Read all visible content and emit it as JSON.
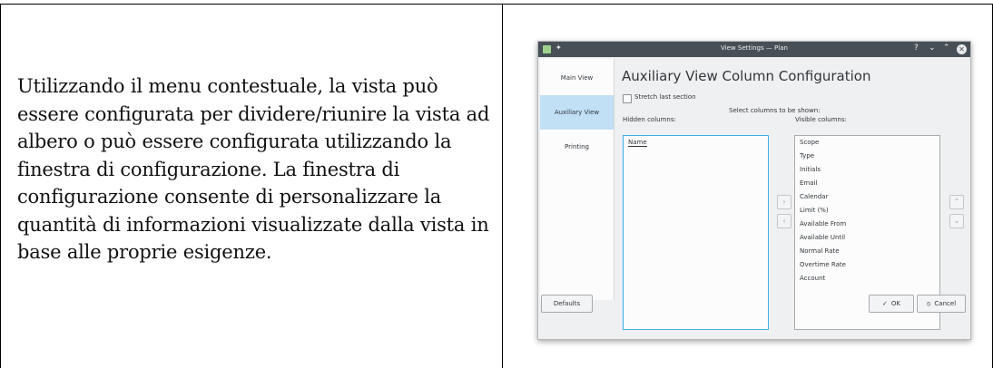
{
  "paragraph": "Utilizzando il menu contestuale, la vista può essere configurata per dividere/riunire la vista ad albero o può essere configurata utilizzando la finestra di configurazione. La finestra di configurazione consente di personalizzare la quantità di informazioni visualizzate dalla vista in base alle proprie esigenze.",
  "dialog": {
    "title": "View Settings — Plan",
    "titlebar_icons": {
      "app": "app-icon",
      "pin": "pin-icon",
      "help": "?",
      "minimize": "⌄",
      "maximize": "⌃",
      "close": "✕"
    },
    "sidebar": [
      {
        "label": "Main View",
        "selected": false
      },
      {
        "label": "Auxiliary View",
        "selected": true
      },
      {
        "label": "Printing",
        "selected": false
      }
    ],
    "heading": "Auxiliary View Column Configuration",
    "stretch_label": "Stretch last section",
    "stretch_checked": false,
    "select_label": "Select columns to be shown:",
    "hidden_label": "Hidden columns:",
    "visible_label": "Visible columns:",
    "hidden_columns": [
      "Name"
    ],
    "visible_columns": [
      "Scope",
      "Type",
      "Initials",
      "Email",
      "Calendar",
      "Limit (%)",
      "Available From",
      "Available Until",
      "Normal Rate",
      "Overtime Rate",
      "Account"
    ],
    "arrows": {
      "right": "›",
      "left": "‹",
      "up": "⌃",
      "down": "⌄"
    },
    "buttons": {
      "defaults": "Defaults",
      "ok": "OK",
      "ok_icon": "✓",
      "cancel": "Cancel",
      "cancel_icon": "⦸"
    },
    "colors": {
      "titlebar": "#475057",
      "selection": "#c2e0f5",
      "focus": "#3daee9",
      "window_bg": "#eff0f1"
    }
  }
}
